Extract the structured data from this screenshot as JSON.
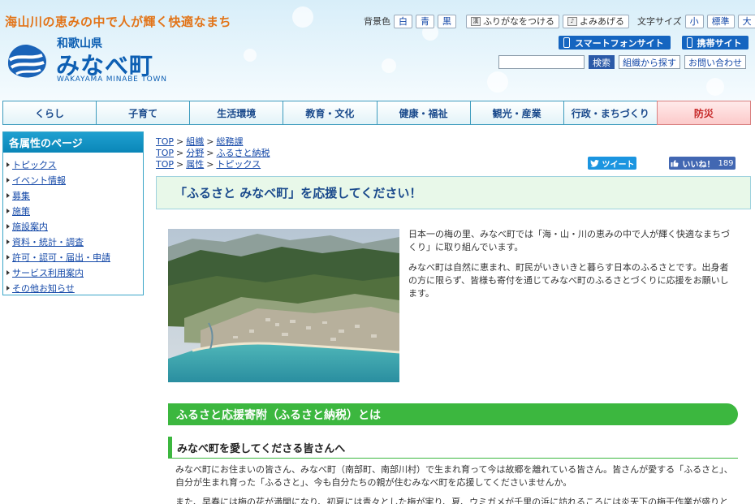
{
  "header": {
    "tagline": "海山川の恵みの中で人が輝く快適なまち",
    "prefecture": "和歌山県",
    "town": "みなべ町",
    "town_roman": "WAKAYAMA MINABE TOWN",
    "bg_label": "背景色",
    "bg_options": [
      "白",
      "青",
      "黒"
    ],
    "furigana": "ふりがなをつける",
    "readaloud": "よみあげる",
    "fontsize_label": "文字サイズ",
    "fontsize_options": [
      "小",
      "標準",
      "大"
    ],
    "smartphone": "スマートフォンサイト",
    "mobile": "携帯サイト",
    "search_placeholder": "",
    "search_button": "検索",
    "org_search": "組織から探す",
    "contact": "お問い合わせ",
    "furigana_icon_char": "漢",
    "read_icon_char": "♪"
  },
  "nav": [
    "くらし",
    "子育て",
    "生活環境",
    "教育・文化",
    "健康・福祉",
    "観光・産業",
    "行政・まちづくり",
    "防災"
  ],
  "sidebar": {
    "title": "各属性のページ",
    "items": [
      "トピックス",
      "イベント情報",
      "募集",
      "施策",
      "施設案内",
      "資料・統計・調査",
      "許可・認可・届出・申請",
      "サービス利用案内",
      "その他お知らせ"
    ]
  },
  "breadcrumbs": [
    [
      "TOP",
      "組織",
      "総務課"
    ],
    [
      "TOP",
      "分野",
      "ふるさと納税"
    ],
    [
      "TOP",
      "属性",
      "トピックス"
    ]
  ],
  "breadcrumb_sep": ">",
  "social": {
    "tweet": "ツイート",
    "like": "いいね！",
    "like_count": "189"
  },
  "page_title": "「ふるさと みなべ町」を応援してください！",
  "intro": [
    "日本一の梅の里、みなべ町では「海・山・川の恵みの中で人が輝く快適なまちづくり」に取り組んでいます。",
    "みなべ町は自然に恵まれ、町民がいきいきと暮らす日本のふるさとです。出身者の方に限らず、皆様も寄付を通じてみなべ町のふるさとづくりに応援をお願いします。"
  ],
  "section_h2": "ふるさと応援寄附（ふるさと納税）とは",
  "section_h3": "みなべ町を愛してくださる皆さんへ",
  "body": [
    "みなべ町にお住まいの皆さん、みなべ町（南部町、南部川村）で生まれ育って今は故郷を離れている皆さん。皆さんが愛する「ふるさと」、自分が生まれ育った「ふるさと」、今も自分たちの親が住むみなべ町を応援してくださいませんか。",
    "また、早春には梅の花が満開になり、初夏には青々とした梅が実り、夏、ウミガメが千里の浜に訪れるころには炎天下の梅干作業が盛りと"
  ],
  "colors": {
    "tagline": "#e27418",
    "brand_blue": "#0d5fb3",
    "nav_border": "#3d9bbd",
    "disaster": "#c62828",
    "accent_green": "#3cb73f",
    "sidebar_head": "#0a86b8"
  }
}
